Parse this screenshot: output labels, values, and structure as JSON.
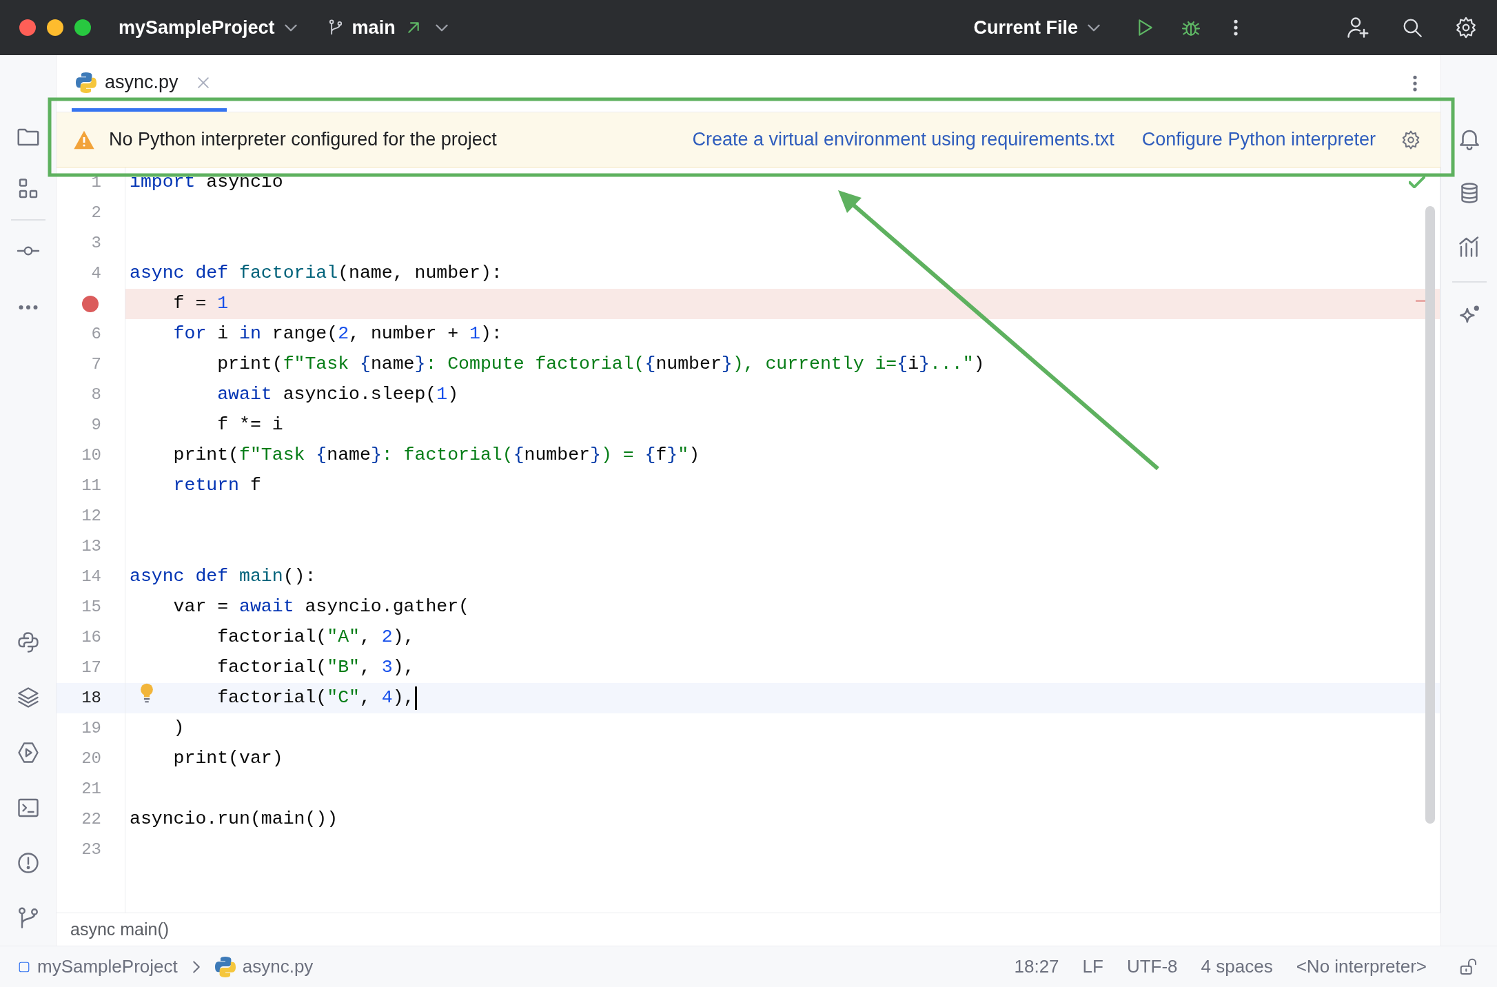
{
  "title_bar": {
    "project": "mySampleProject",
    "branch": "main",
    "run_config": "Current File"
  },
  "tabs": [
    {
      "label": "async.py",
      "selected": true
    }
  ],
  "banner": {
    "message": "No Python interpreter configured for the project",
    "actions": [
      "Create a virtual environment using requirements.txt",
      "Configure Python interpreter"
    ]
  },
  "editor": {
    "lines": [
      {
        "number": "1",
        "breakpoint": false,
        "current": false,
        "bulb": false,
        "tokens": [
          {
            "text": "import",
            "kind": "kw"
          },
          {
            "text": " asyncio",
            "kind": "plain"
          }
        ]
      },
      {
        "number": "2",
        "breakpoint": false,
        "current": false,
        "bulb": false
      },
      {
        "number": "3",
        "breakpoint": false,
        "current": false,
        "bulb": false
      },
      {
        "number": "4",
        "breakpoint": false,
        "current": false,
        "bulb": false,
        "tokens": [
          {
            "text": "async def",
            "kind": "kw"
          },
          {
            "text": " factorial",
            "kind": "fn"
          },
          {
            "text": "(name, number):",
            "kind": "plain"
          }
        ]
      },
      {
        "breakpoint": true,
        "current": false,
        "bulb": false,
        "tokens": [
          {
            "text": "    f = ",
            "kind": "plain"
          },
          {
            "text": "1",
            "kind": "num"
          }
        ]
      },
      {
        "number": "6",
        "breakpoint": false,
        "current": false,
        "bulb": false,
        "tokens": [
          {
            "text": "    for",
            "kind": "kw"
          },
          {
            "text": " i ",
            "kind": "plain"
          },
          {
            "text": "in",
            "kind": "kw"
          },
          {
            "text": " range(",
            "kind": "plain"
          },
          {
            "text": "2",
            "kind": "num"
          },
          {
            "text": ", number + ",
            "kind": "plain"
          },
          {
            "text": "1",
            "kind": "num"
          },
          {
            "text": "):",
            "kind": "plain"
          }
        ]
      },
      {
        "number": "7",
        "breakpoint": false,
        "current": false,
        "bulb": false,
        "tokens": [
          {
            "text": "        print(",
            "kind": "plain"
          },
          {
            "text": "f\"Task ",
            "kind": "str"
          },
          {
            "text": "{",
            "kind": "brace"
          },
          {
            "text": "name",
            "kind": "plain"
          },
          {
            "text": "}",
            "kind": "brace"
          },
          {
            "text": ": Compute factorial(",
            "kind": "str"
          },
          {
            "text": "{",
            "kind": "brace"
          },
          {
            "text": "number",
            "kind": "plain"
          },
          {
            "text": "}",
            "kind": "brace"
          },
          {
            "text": "), currently i=",
            "kind": "str"
          },
          {
            "text": "{",
            "kind": "brace"
          },
          {
            "text": "i",
            "kind": "plain"
          },
          {
            "text": "}",
            "kind": "brace"
          },
          {
            "text": "...\"",
            "kind": "str"
          },
          {
            "text": ")",
            "kind": "plain"
          }
        ]
      },
      {
        "number": "8",
        "breakpoint": false,
        "current": false,
        "bulb": false,
        "tokens": [
          {
            "text": "        await",
            "kind": "kw"
          },
          {
            "text": " asyncio.sleep(",
            "kind": "plain"
          },
          {
            "text": "1",
            "kind": "num"
          },
          {
            "text": ")",
            "kind": "plain"
          }
        ]
      },
      {
        "number": "9",
        "breakpoint": false,
        "current": false,
        "bulb": false,
        "tokens": [
          {
            "text": "        f *= i",
            "kind": "plain"
          }
        ]
      },
      {
        "number": "10",
        "breakpoint": false,
        "current": false,
        "bulb": false,
        "tokens": [
          {
            "text": "    print(",
            "kind": "plain"
          },
          {
            "text": "f\"Task ",
            "kind": "str"
          },
          {
            "text": "{",
            "kind": "brace"
          },
          {
            "text": "name",
            "kind": "plain"
          },
          {
            "text": "}",
            "kind": "brace"
          },
          {
            "text": ": factorial(",
            "kind": "str"
          },
          {
            "text": "{",
            "kind": "brace"
          },
          {
            "text": "number",
            "kind": "plain"
          },
          {
            "text": "}",
            "kind": "brace"
          },
          {
            "text": ") = ",
            "kind": "str"
          },
          {
            "text": "{",
            "kind": "brace"
          },
          {
            "text": "f",
            "kind": "plain"
          },
          {
            "text": "}",
            "kind": "brace"
          },
          {
            "text": "\"",
            "kind": "str"
          },
          {
            "text": ")",
            "kind": "plain"
          }
        ]
      },
      {
        "number": "11",
        "breakpoint": false,
        "current": false,
        "bulb": false,
        "tokens": [
          {
            "text": "    return",
            "kind": "kw"
          },
          {
            "text": " f",
            "kind": "plain"
          }
        ]
      },
      {
        "number": "12",
        "breakpoint": false,
        "current": false,
        "bulb": false
      },
      {
        "number": "13",
        "breakpoint": false,
        "current": false,
        "bulb": false
      },
      {
        "number": "14",
        "breakpoint": false,
        "current": false,
        "bulb": false,
        "tokens": [
          {
            "text": "async def",
            "kind": "kw"
          },
          {
            "text": " main",
            "kind": "fn"
          },
          {
            "text": "():",
            "kind": "plain"
          }
        ]
      },
      {
        "number": "15",
        "breakpoint": false,
        "current": false,
        "bulb": false,
        "tokens": [
          {
            "text": "    var = ",
            "kind": "plain"
          },
          {
            "text": "await",
            "kind": "kw"
          },
          {
            "text": " asyncio.gather(",
            "kind": "plain"
          }
        ]
      },
      {
        "number": "16",
        "breakpoint": false,
        "current": false,
        "bulb": false,
        "tokens": [
          {
            "text": "        factorial(",
            "kind": "plain"
          },
          {
            "text": "\"A\"",
            "kind": "str"
          },
          {
            "text": ", ",
            "kind": "plain"
          },
          {
            "text": "2",
            "kind": "num"
          },
          {
            "text": "),",
            "kind": "plain"
          }
        ]
      },
      {
        "number": "17",
        "breakpoint": false,
        "current": false,
        "bulb": false,
        "tokens": [
          {
            "text": "        factorial(",
            "kind": "plain"
          },
          {
            "text": "\"B\"",
            "kind": "str"
          },
          {
            "text": ", ",
            "kind": "plain"
          },
          {
            "text": "3",
            "kind": "num"
          },
          {
            "text": "),",
            "kind": "plain"
          }
        ]
      },
      {
        "number": "18",
        "breakpoint": false,
        "current": true,
        "bulb": true,
        "tokens": [
          {
            "text": "        factorial(",
            "kind": "plain"
          },
          {
            "text": "\"C\"",
            "kind": "str"
          },
          {
            "text": ", ",
            "kind": "plain"
          },
          {
            "text": "4",
            "kind": "num"
          },
          {
            "text": "),",
            "kind": "plain"
          }
        ]
      },
      {
        "number": "19",
        "breakpoint": false,
        "current": false,
        "bulb": false,
        "tokens": [
          {
            "text": "    )",
            "kind": "plain"
          }
        ]
      },
      {
        "number": "20",
        "breakpoint": false,
        "current": false,
        "bulb": false,
        "tokens": [
          {
            "text": "    print(var)",
            "kind": "plain"
          }
        ]
      },
      {
        "number": "21",
        "breakpoint": false,
        "current": false,
        "bulb": false
      },
      {
        "number": "22",
        "breakpoint": false,
        "current": false,
        "bulb": false,
        "tokens": [
          {
            "text": "asyncio.run(main())",
            "kind": "plain"
          }
        ]
      },
      {
        "number": "23",
        "breakpoint": false,
        "current": false,
        "bulb": false
      }
    ]
  },
  "breadcrumb": "async main()",
  "status_bar": {
    "path": [
      {
        "label": "mySampleProject",
        "kind": "project"
      },
      {
        "label": "async.py",
        "kind": "file"
      }
    ],
    "items": [
      "18:27",
      "LF",
      "UTF-8",
      "4 spaces",
      "<No interpreter>"
    ]
  }
}
